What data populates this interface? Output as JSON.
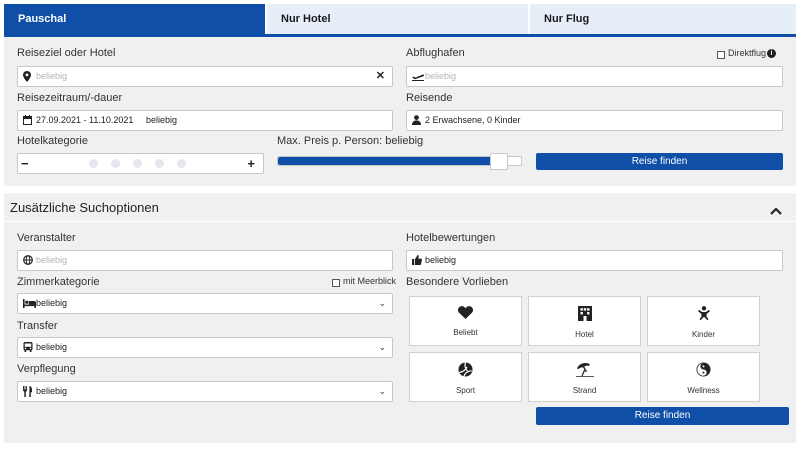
{
  "tabs": [
    {
      "label": "Pauschal",
      "active": true
    },
    {
      "label": "Nur Hotel",
      "active": false
    },
    {
      "label": "Nur Flug",
      "active": false
    }
  ],
  "search": {
    "destination_label": "Reiseziel oder Hotel",
    "destination_placeholder": "beliebig",
    "departure_label": "Abflughafen",
    "direct_flight_label": "Direktflug",
    "departure_placeholder": "beliebig",
    "travel_period_label": "Reisezeitraum/-dauer",
    "travel_period_dates": "27.09.2021 - 11.10.2021",
    "travel_period_duration": "beliebig",
    "travelers_label": "Reisende",
    "travelers_value": "2 Erwachsene, 0 Kinder",
    "hotel_category_label": "Hotelkategorie",
    "hotel_category_minus": "−",
    "hotel_category_plus": "+",
    "hotel_category_stars_selected": 0,
    "hotel_category_stars_total": 5,
    "max_price_label": "Max. Preis p. Person: beliebig",
    "max_price_slider_fraction": 0.94,
    "submit_label": "Reise finden"
  },
  "extra": {
    "header_label": "Zusätzliche Suchoptionen",
    "collapse_icon": "chevron-up",
    "organizer_label": "Veranstalter",
    "organizer_placeholder": "beliebig",
    "hotel_ratings_label": "Hotelbewertungen",
    "hotel_ratings_value": "beliebig",
    "room_category_label": "Zimmerkategorie",
    "sea_view_label": "mit Meerblick",
    "room_category_value": "beliebig",
    "transfer_label": "Transfer",
    "transfer_value": "beliebig",
    "catering_label": "Verpflegung",
    "catering_value": "beliebig",
    "preferences_label": "Besondere Vorlieben",
    "preferences": [
      {
        "label": "Beliebt",
        "icon": "heart-icon"
      },
      {
        "label": "Hotel",
        "icon": "hotel-icon"
      },
      {
        "label": "Kinder",
        "icon": "child-icon"
      },
      {
        "label": "Sport",
        "icon": "ball-icon"
      },
      {
        "label": "Strand",
        "icon": "beach-umbrella-icon"
      },
      {
        "label": "Wellness",
        "icon": "yin-yang-icon"
      }
    ],
    "submit_label": "Reise finden"
  },
  "colors": {
    "primary": "#0f4fa8",
    "panel": "#f0f0f0",
    "tab_inactive": "#e6eef8"
  }
}
